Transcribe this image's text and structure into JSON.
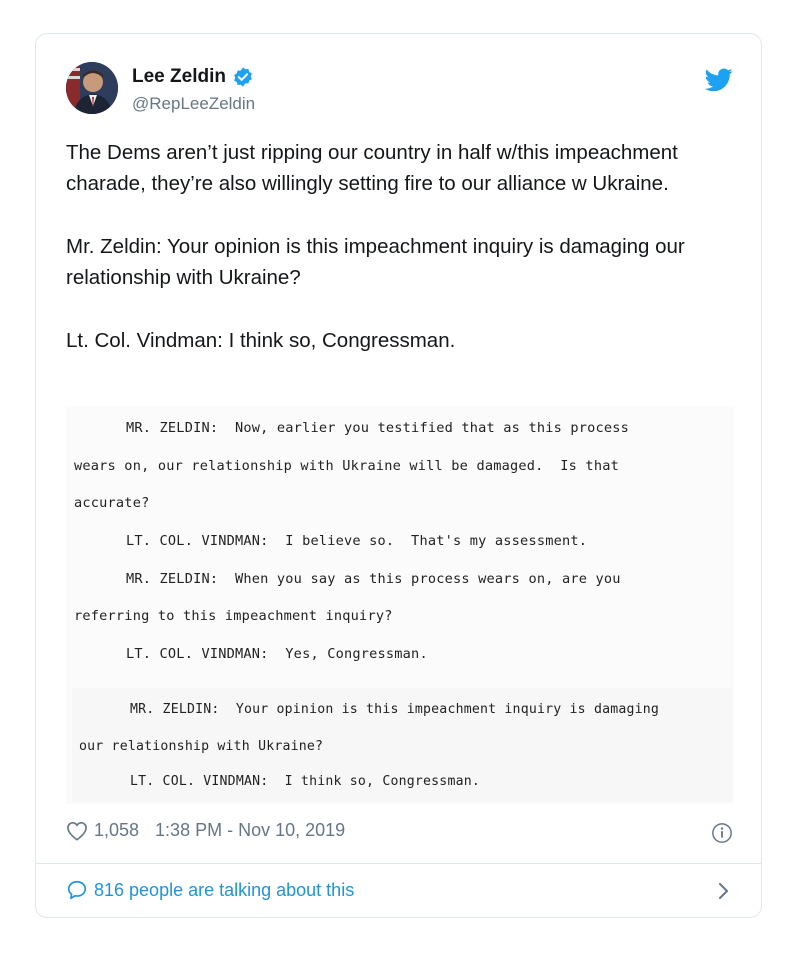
{
  "author": {
    "name": "Lee Zeldin",
    "handle": "@RepLeeZeldin"
  },
  "tweet": {
    "paragraphs": [
      "The Dems aren’t just ripping our country in half w/this impeachment charade, they’re also willingly setting fire to our alliance w Ukraine.",
      "Mr. Zeldin: Your opinion is this impeachment inquiry is damaging our relationship with Ukraine?",
      "Lt. Col. Vindman: I think so, Congressman."
    ]
  },
  "transcript": {
    "lines": [
      "MR. ZELDIN:  Now, earlier you testified that as this process",
      "wears on, our relationship with Ukraine will be damaged.  Is that",
      "accurate?",
      "LT. COL. VINDMAN:  I believe so.  That's my assessment.",
      "MR. ZELDIN:  When you say as this process wears on, are you",
      "referring to this impeachment inquiry?",
      "LT. COL. VINDMAN:  Yes, Congressman.",
      "MR. ZELDIN:  Your opinion is this impeachment inquiry is damaging",
      "our relationship with Ukraine?",
      "LT. COL. VINDMAN:  I think so, Congressman."
    ]
  },
  "footer": {
    "likes": "1,058",
    "timestamp": "1:38 PM - Nov 10, 2019",
    "talking": "816 people are talking about this"
  },
  "icons": {
    "verified": "verified-badge-icon",
    "twitter": "twitter-bird-icon",
    "like": "heart-icon",
    "info": "info-icon",
    "reply": "speech-bubble-icon",
    "chevron": "chevron-right-icon"
  },
  "colors": {
    "brand": "#1da1f2",
    "link": "#1b95e0",
    "muted": "#657786"
  }
}
